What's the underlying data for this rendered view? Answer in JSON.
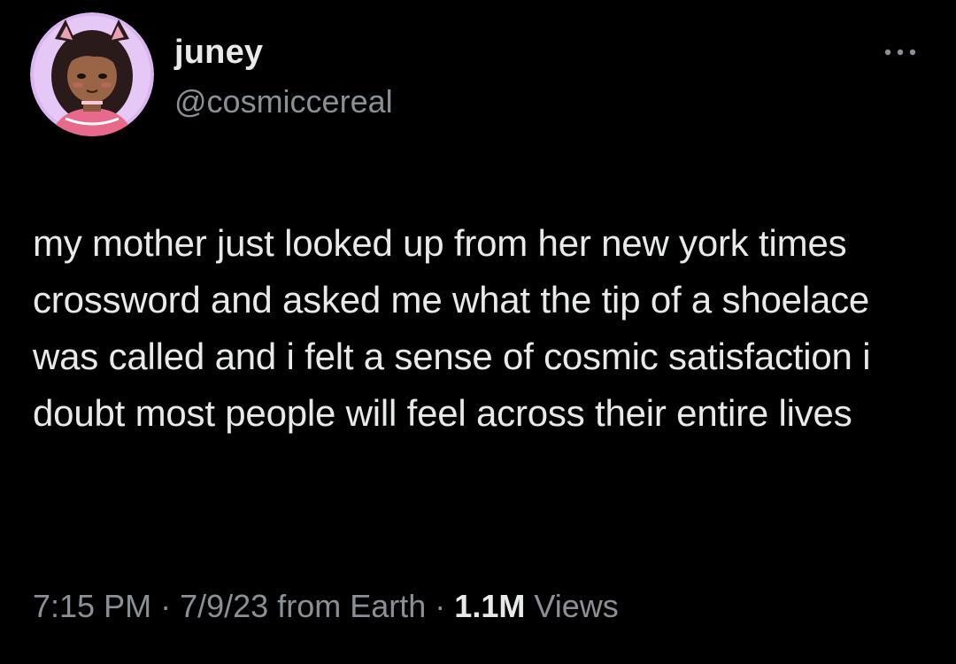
{
  "author": {
    "display_name": "juney",
    "handle": "@cosmiccereal",
    "avatar_icon": "cartoon-girl-avatar"
  },
  "more_menu_icon": "more-dots-icon",
  "tweet": {
    "text": "my mother just looked up from her new york times crossword and asked me what the tip of a shoelace was called and i felt a sense of cosmic satisfaction i doubt most people will feel across their entire lives"
  },
  "meta": {
    "time": "7:15 PM",
    "separator": "·",
    "date": "7/9/23",
    "source": "from Earth",
    "views_count": "1.1M",
    "views_label": "Views"
  },
  "colors": {
    "background": "#000000",
    "primary_text": "#e7e9ea",
    "secondary_text": "#8b9096",
    "avatar_bg": "#d9b6f0"
  }
}
